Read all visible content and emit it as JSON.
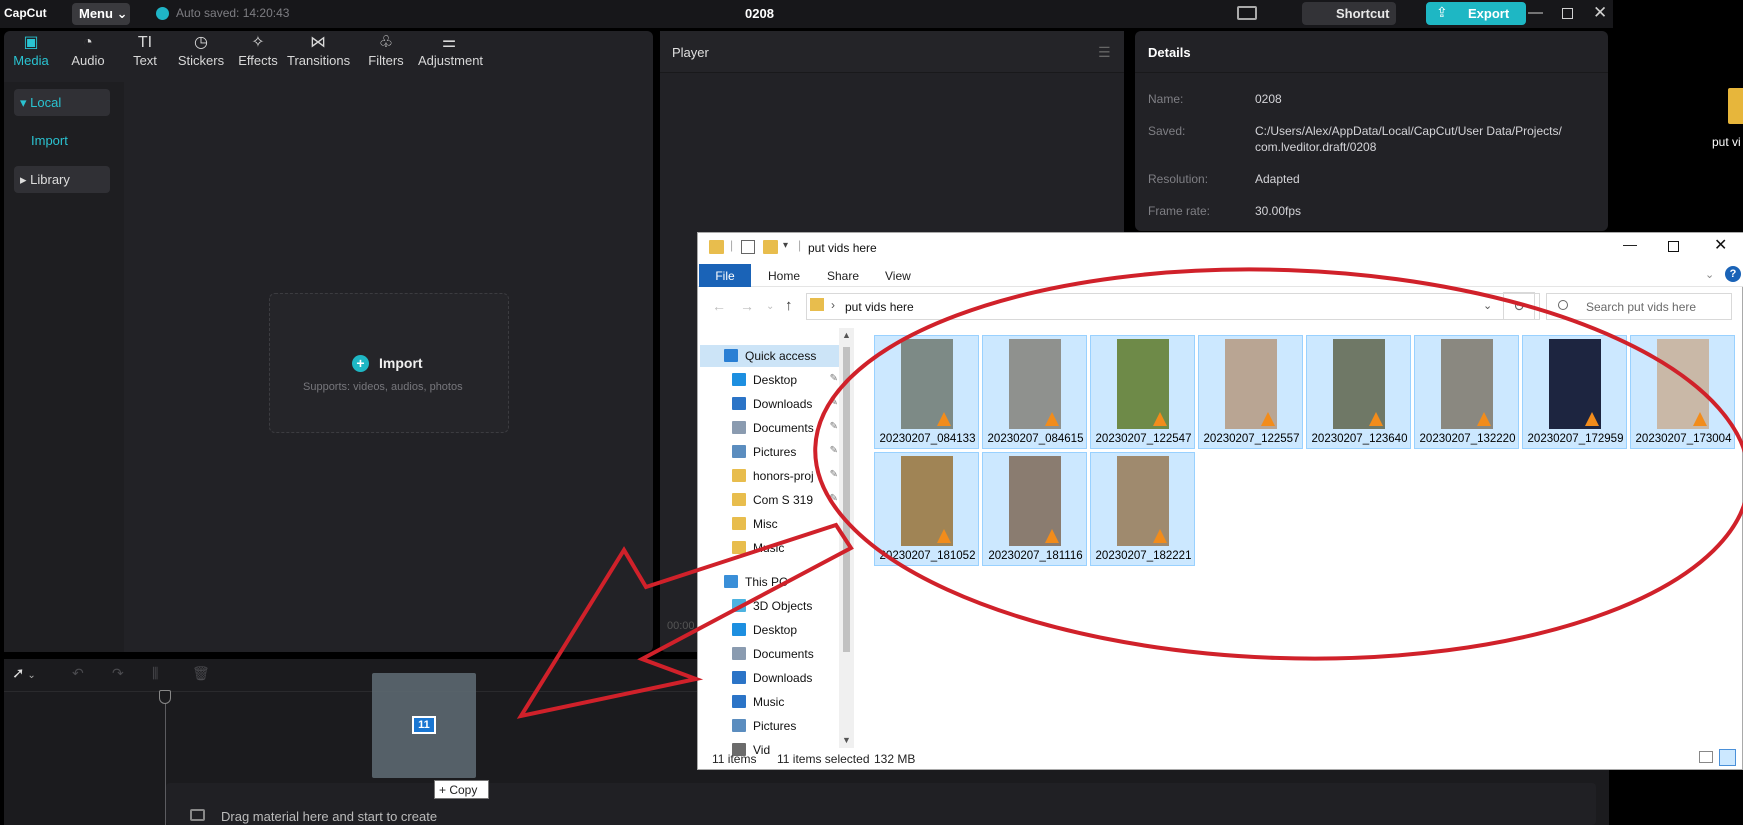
{
  "app": {
    "logo": "CapCut",
    "menu_label": "Menu",
    "autosave": "Auto saved: 14:20:43",
    "project_title": "0208",
    "shortcut_label": "Shortcut",
    "export_label": "Export",
    "accent_color": "#1eb7c4"
  },
  "toolbar": [
    {
      "label": "Media",
      "icon": "media-icon",
      "active": true
    },
    {
      "label": "Audio",
      "icon": "audio-icon"
    },
    {
      "label": "Text",
      "icon": "text-icon"
    },
    {
      "label": "Stickers",
      "icon": "stickers-icon"
    },
    {
      "label": "Effects",
      "icon": "effects-icon"
    },
    {
      "label": "Transitions",
      "icon": "transitions-icon"
    },
    {
      "label": "Filters",
      "icon": "filters-icon"
    },
    {
      "label": "Adjustment",
      "icon": "adjustment-icon"
    }
  ],
  "media_sidebar": {
    "local": "Local",
    "import": "Import",
    "library": "Library"
  },
  "import_box": {
    "label": "Import",
    "sub": "Supports: videos, audios, photos"
  },
  "player": {
    "title": "Player",
    "time": "00:00"
  },
  "details": {
    "title": "Details",
    "rows": [
      {
        "key": "Name:",
        "value": "0208"
      },
      {
        "key": "Saved:",
        "value": "C:/Users/Alex/AppData/Local/CapCut/User Data/Projects/",
        "value2": "com.lveditor.draft/0208"
      },
      {
        "key": "Resolution:",
        "value": "Adapted"
      },
      {
        "key": "Frame rate:",
        "value": "30.00fps"
      }
    ]
  },
  "desktop_icon_label": "put vi",
  "timeline": {
    "drop_hint": "Drag material here and start to create",
    "drag_count": "11",
    "copy_tooltip": "+ Copy"
  },
  "explorer": {
    "title": "put vids here",
    "ribbon_tabs": [
      "File",
      "Home",
      "Share",
      "View"
    ],
    "help": "?",
    "address": "put vids here",
    "search_placeholder": "Search put vids here",
    "nav_items": [
      {
        "label": "Quick access",
        "icon": "star-icon",
        "top": true,
        "selected": true
      },
      {
        "label": "Desktop",
        "icon": "desktop-icon",
        "pinned": true
      },
      {
        "label": "Downloads",
        "icon": "downloads-icon",
        "pinned": true
      },
      {
        "label": "Documents",
        "icon": "documents-icon",
        "pinned": true
      },
      {
        "label": "Pictures",
        "icon": "pictures-icon",
        "pinned": true
      },
      {
        "label": "honors-proj",
        "icon": "folder-icon",
        "pinned": true
      },
      {
        "label": "Com S 319",
        "icon": "folder-icon",
        "pinned": true
      },
      {
        "label": "Misc",
        "icon": "folder-icon"
      },
      {
        "label": "Music",
        "icon": "folder-icon"
      },
      {
        "label": "",
        "icon": "spacer"
      },
      {
        "label": "This PC",
        "icon": "pc-icon",
        "top": true
      },
      {
        "label": "3D Objects",
        "icon": "3d-objects-icon"
      },
      {
        "label": "Desktop",
        "icon": "desktop-icon"
      },
      {
        "label": "Documents",
        "icon": "documents-icon"
      },
      {
        "label": "Downloads",
        "icon": "downloads-icon"
      },
      {
        "label": "Music",
        "icon": "music-icon"
      },
      {
        "label": "Pictures",
        "icon": "pictures-icon"
      },
      {
        "label": "Vid",
        "icon": "videos-icon"
      }
    ],
    "files": [
      {
        "name": "20230207_084133",
        "thumb": "#7d8a86"
      },
      {
        "name": "20230207_084615",
        "thumb": "#8f918e"
      },
      {
        "name": "20230207_122547",
        "thumb": "#6e8a48"
      },
      {
        "name": "20230207_122557",
        "thumb": "#b9a593"
      },
      {
        "name": "20230207_123640",
        "thumb": "#6f7866"
      },
      {
        "name": "20230207_132220",
        "thumb": "#8a8880"
      },
      {
        "name": "20230207_172959",
        "thumb": "#1d2540"
      },
      {
        "name": "20230207_173004",
        "thumb": "#c9b8a7"
      },
      {
        "name": "20230207_181052",
        "thumb": "#a08455"
      },
      {
        "name": "20230207_181116",
        "thumb": "#8a7c70"
      },
      {
        "name": "20230207_182221",
        "thumb": "#9f8a6e"
      }
    ],
    "status": {
      "items": "11 items",
      "selected": "11 items selected",
      "size": "132 MB"
    }
  },
  "annotation_color": "#d0212a"
}
